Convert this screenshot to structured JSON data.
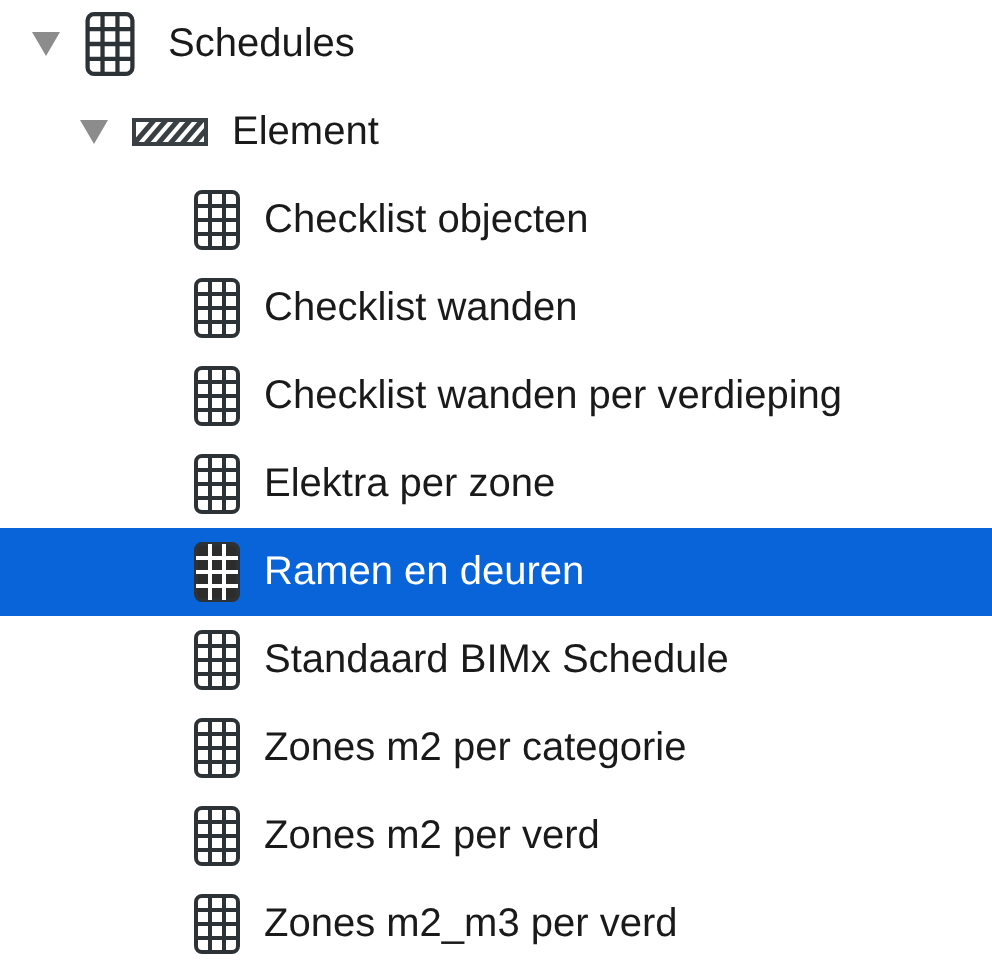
{
  "tree": [
    {
      "label": "Schedules",
      "kind": "table",
      "expanded": true,
      "selected": false,
      "children": [
        {
          "label": "Element",
          "kind": "hatch",
          "expanded": true,
          "selected": false,
          "children": [
            {
              "label": "Checklist objecten",
              "kind": "table",
              "selected": false
            },
            {
              "label": "Checklist wanden",
              "kind": "table",
              "selected": false
            },
            {
              "label": "Checklist wanden per verdieping",
              "kind": "table",
              "selected": false
            },
            {
              "label": "Elektra per zone",
              "kind": "table",
              "selected": false
            },
            {
              "label": "Ramen en deuren",
              "kind": "table",
              "selected": true
            },
            {
              "label": "Standaard BIMx Schedule",
              "kind": "table",
              "selected": false
            },
            {
              "label": "Zones m2 per categorie",
              "kind": "table",
              "selected": false
            },
            {
              "label": "Zones m2 per verd",
              "kind": "table",
              "selected": false
            },
            {
              "label": "Zones m2_m3 per verd",
              "kind": "table",
              "selected": false
            }
          ]
        }
      ]
    }
  ]
}
